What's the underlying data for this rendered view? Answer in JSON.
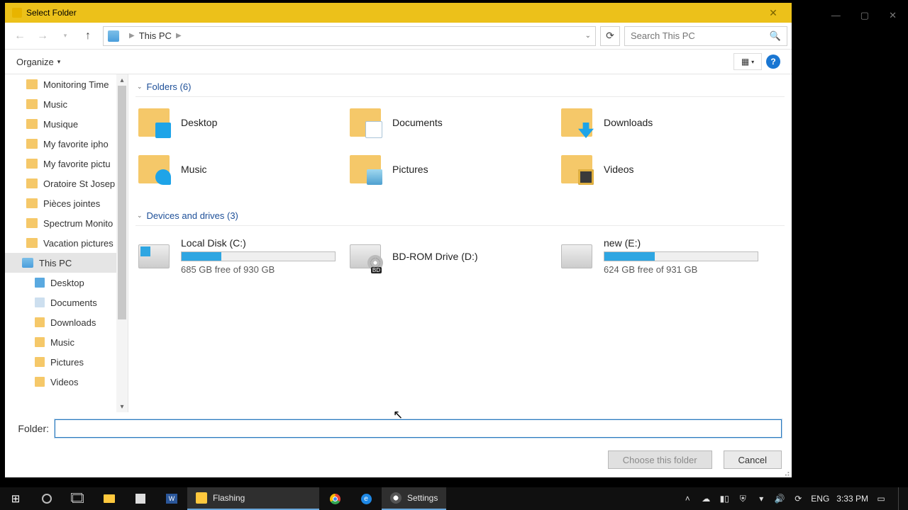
{
  "window": {
    "title": "Select Folder"
  },
  "breadcrumb": {
    "location": "This PC"
  },
  "search": {
    "placeholder": "Search This PC"
  },
  "toolbar": {
    "organize": "Organize"
  },
  "tree": {
    "items": [
      {
        "label": "Monitoring Time"
      },
      {
        "label": "Music"
      },
      {
        "label": "Musique"
      },
      {
        "label": "My favorite ipho"
      },
      {
        "label": "My favorite pictu"
      },
      {
        "label": "Oratoire St Josep"
      },
      {
        "label": "Pièces jointes"
      },
      {
        "label": "Spectrum Monito"
      },
      {
        "label": "Vacation pictures"
      }
    ],
    "this_pc": "This PC",
    "subs": [
      {
        "label": "Desktop",
        "cls": "i-desktop"
      },
      {
        "label": "Documents",
        "cls": "i-doc"
      },
      {
        "label": "Downloads",
        "cls": "i-down"
      },
      {
        "label": "Music",
        "cls": "i-mus"
      },
      {
        "label": "Pictures",
        "cls": "i-pic"
      },
      {
        "label": "Videos",
        "cls": "i-vid"
      }
    ]
  },
  "groups": {
    "folders_label": "Folders (6)",
    "drives_label": "Devices and drives (3)"
  },
  "folders": [
    {
      "name": "Desktop",
      "cls": "desk"
    },
    {
      "name": "Documents",
      "cls": "docu"
    },
    {
      "name": "Downloads",
      "cls": "down"
    },
    {
      "name": "Music",
      "cls": "musi"
    },
    {
      "name": "Pictures",
      "cls": "pict"
    },
    {
      "name": "Videos",
      "cls": "vide"
    }
  ],
  "drives": [
    {
      "name": "Local Disk (C:)",
      "free": "685 GB free of 930 GB",
      "pct": 26,
      "cls": "win"
    },
    {
      "name": "BD-ROM Drive (D:)",
      "free": "",
      "pct": -1,
      "cls": "bd"
    },
    {
      "name": "new (E:)",
      "free": "624 GB free of 931 GB",
      "pct": 33,
      "cls": ""
    }
  ],
  "footer": {
    "folder_label": "Folder:",
    "folder_value": "",
    "choose": "Choose this folder",
    "cancel": "Cancel"
  },
  "taskbar": {
    "tasks": [
      {
        "label": "Flashing",
        "active": true,
        "icon": "folder"
      },
      {
        "label": "Settings",
        "active": true,
        "icon": "gear"
      }
    ],
    "lang": "ENG",
    "time": "3:33 PM"
  }
}
